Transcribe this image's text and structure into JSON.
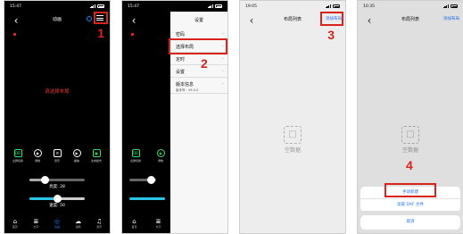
{
  "panel1": {
    "time": "15:47",
    "title": "动画",
    "prompt": "请选择布局",
    "step": "1",
    "controls": [
      {
        "icon": "DB",
        "label": "全屏切换"
      },
      {
        "icon": "◉",
        "label": "录制"
      },
      {
        "icon": "♬",
        "label": "音乐"
      },
      {
        "icon": "▶",
        "label": "播放"
      },
      {
        "icon": "▣",
        "label": "生成模式"
      }
    ],
    "brightness_label": "亮度: 28",
    "brightness_value": 0.28,
    "speed_label": "速度: 50",
    "speed_value": 0.5,
    "tabs": [
      {
        "icon": "⌂",
        "label": "首页"
      },
      {
        "icon": "≣",
        "label": "文字"
      },
      {
        "icon": "◎",
        "label": "动画"
      },
      {
        "icon": "☁",
        "label": "涂鸦"
      },
      {
        "icon": "♫",
        "label": "音乐"
      }
    ]
  },
  "panel2": {
    "time": "15:47",
    "title": "设置",
    "step": "2",
    "menu": [
      {
        "label": "密码",
        "sub": ""
      },
      {
        "label": "选择布局",
        "sub": ""
      },
      {
        "label": "定时",
        "sub": ""
      },
      {
        "label": "设置",
        "sub": ""
      },
      {
        "label": "版本信息",
        "sub": "版本号：V6.0.0"
      }
    ]
  },
  "panel3": {
    "time": "19:05",
    "title": "布局列表",
    "add_label": "添加布局",
    "empty_text": "空数据",
    "step": "3"
  },
  "panel4": {
    "time": "10:35",
    "title": "布局列表",
    "add_label": "添加布局",
    "empty_text": "空数据",
    "step": "4",
    "sheet_items": [
      "手动新建",
      "读取 DXF 文件"
    ],
    "cancel_label": "取消"
  },
  "colors": {
    "highlight": "#d9231d",
    "accent_blue": "#1e6fff",
    "icon_green": "#2fe06a"
  }
}
